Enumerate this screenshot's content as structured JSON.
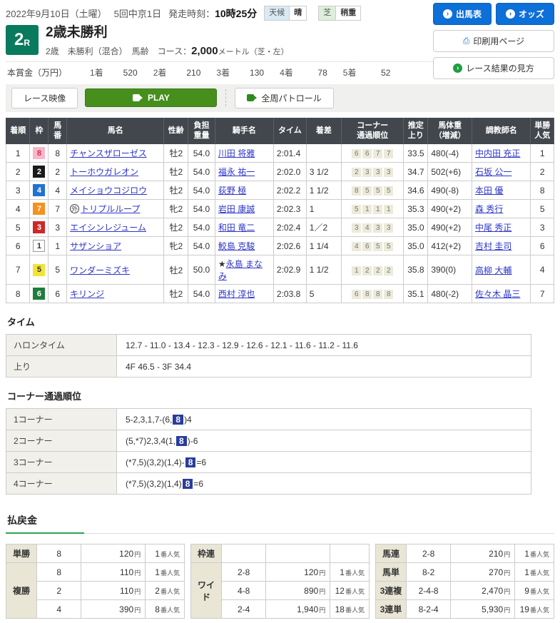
{
  "header": {
    "date": "2022年9月10日（土曜）",
    "meet": "5回中京1日",
    "start_label": "発走時刻：",
    "start_time": "10時25分",
    "weather_label": "天候",
    "weather_value": "晴",
    "turf_label": "芝",
    "turf_value": "稍重",
    "btn_shutsuba": "出馬表",
    "btn_odds": "オッズ",
    "btn_print": "印刷用ページ",
    "btn_guide": "レース結果の見方",
    "arrow_glyph": "›",
    "printer_glyph": "⎙"
  },
  "race": {
    "number": "2",
    "r_suffix": "R",
    "title": "2歳未勝利",
    "conditions": "2歳　未勝利（混合）　馬齢　コース：",
    "distance": "2,000",
    "distance_unit": "メートル（芝・左）"
  },
  "prize": {
    "label": "本賞金（万円）",
    "items": [
      {
        "rank": "1着",
        "amount": "520"
      },
      {
        "rank": "2着",
        "amount": "210"
      },
      {
        "rank": "3着",
        "amount": "130"
      },
      {
        "rank": "4着",
        "amount": "78"
      },
      {
        "rank": "5着",
        "amount": "52"
      }
    ]
  },
  "video_bar": {
    "race_video": "レース映像",
    "play": "PLAY",
    "patrol": "全周パトロール"
  },
  "frame_colors": {
    "1": {
      "bg": "#ffffff",
      "fg": "#333333",
      "border": "#999999"
    },
    "2": {
      "bg": "#1a1a1a",
      "fg": "#ffffff"
    },
    "3": {
      "bg": "#cc2929",
      "fg": "#ffffff"
    },
    "4": {
      "bg": "#2272d1",
      "fg": "#ffffff"
    },
    "5": {
      "bg": "#f2e436",
      "fg": "#333333"
    },
    "6": {
      "bg": "#1e7d3c",
      "fg": "#ffffff"
    },
    "7": {
      "bg": "#f5921e",
      "fg": "#ffffff"
    },
    "8": {
      "bg": "#f7b7ca",
      "fg": "#cc3355"
    }
  },
  "results": {
    "columns": [
      "着順",
      "枠",
      "馬\n番",
      "馬名",
      "性齢",
      "負担\n重量",
      "騎手名",
      "タイム",
      "着差",
      "コーナー\n通過順位",
      "推定\n上り",
      "馬体重\n（増減）",
      "調教師名",
      "単勝\n人気"
    ],
    "rows": [
      {
        "pos": "1",
        "frame": "8",
        "num": "8",
        "mark": "",
        "horse": "チャンスザローゼス",
        "sex_age": "牡2",
        "weight": "54.0",
        "jockey_mark": "",
        "jockey": "川田 将雅",
        "time": "2:01.4",
        "margin": "",
        "corners": [
          "6",
          "6",
          "7",
          "7"
        ],
        "last3f": "33.5",
        "horse_weight": "480(-4)",
        "trainer": "中内田 充正",
        "pop": "1"
      },
      {
        "pos": "2",
        "frame": "2",
        "num": "2",
        "mark": "",
        "horse": "トーホウガレオン",
        "sex_age": "牡2",
        "weight": "54.0",
        "jockey_mark": "",
        "jockey": "福永 祐一",
        "time": "2:02.0",
        "margin": "3 1/2",
        "corners": [
          "2",
          "3",
          "3",
          "3"
        ],
        "last3f": "34.7",
        "horse_weight": "502(+6)",
        "trainer": "石坂 公一",
        "pop": "2"
      },
      {
        "pos": "3",
        "frame": "4",
        "num": "4",
        "mark": "",
        "horse": "メイショウコジロウ",
        "sex_age": "牡2",
        "weight": "54.0",
        "jockey_mark": "",
        "jockey": "荻野 極",
        "time": "2:02.2",
        "margin": "1 1/2",
        "corners": [
          "8",
          "5",
          "5",
          "5"
        ],
        "last3f": "34.6",
        "horse_weight": "490(-8)",
        "trainer": "本田 優",
        "pop": "8"
      },
      {
        "pos": "4",
        "frame": "7",
        "num": "7",
        "mark": "外",
        "horse": "トリプルループ",
        "sex_age": "牝2",
        "weight": "54.0",
        "jockey_mark": "",
        "jockey": "岩田 康誠",
        "time": "2:02.3",
        "margin": "1",
        "corners": [
          "5",
          "1",
          "1",
          "1"
        ],
        "last3f": "35.3",
        "horse_weight": "490(+2)",
        "trainer": "森 秀行",
        "pop": "5"
      },
      {
        "pos": "5",
        "frame": "3",
        "num": "3",
        "mark": "",
        "horse": "エイシンレジューム",
        "sex_age": "牡2",
        "weight": "54.0",
        "jockey_mark": "",
        "jockey": "和田 竜二",
        "time": "2:02.4",
        "margin": "1／2",
        "corners": [
          "3",
          "4",
          "3",
          "3"
        ],
        "last3f": "35.0",
        "horse_weight": "490(+2)",
        "trainer": "中尾 秀正",
        "pop": "3"
      },
      {
        "pos": "6",
        "frame": "1",
        "num": "1",
        "mark": "",
        "horse": "サザンショア",
        "sex_age": "牝2",
        "weight": "54.0",
        "jockey_mark": "",
        "jockey": "鮫島 克駿",
        "time": "2:02.6",
        "margin": "1 1/4",
        "corners": [
          "4",
          "6",
          "5",
          "5"
        ],
        "last3f": "35.0",
        "horse_weight": "412(+2)",
        "trainer": "吉村 圭司",
        "pop": "6"
      },
      {
        "pos": "7",
        "frame": "5",
        "num": "5",
        "mark": "",
        "horse": "ワンダーミズキ",
        "sex_age": "牡2",
        "weight": "50.0",
        "jockey_mark": "★",
        "jockey": "永島 まなみ",
        "time": "2:02.9",
        "margin": "1 1/2",
        "corners": [
          "1",
          "2",
          "2",
          "2"
        ],
        "last3f": "35.8",
        "horse_weight": "390(0)",
        "trainer": "高柳 大輔",
        "pop": "4"
      },
      {
        "pos": "8",
        "frame": "6",
        "num": "6",
        "mark": "",
        "horse": "キリンジ",
        "sex_age": "牡2",
        "weight": "54.0",
        "jockey_mark": "",
        "jockey": "西村 淳也",
        "time": "2:03.8",
        "margin": "5",
        "corners": [
          "6",
          "8",
          "8",
          "8"
        ],
        "last3f": "35.1",
        "horse_weight": "480(-2)",
        "trainer": "佐々木 晶三",
        "pop": "7"
      }
    ]
  },
  "time_section": {
    "title": "タイム",
    "rows": [
      {
        "label": "ハロンタイム",
        "value": "12.7 - 11.0 - 13.4 - 12.3 - 12.9 - 12.6 - 12.1 - 11.6 - 11.2 - 11.6"
      },
      {
        "label": "上り",
        "value": "4F 46.5 - 3F 34.4"
      }
    ]
  },
  "corner_section": {
    "title": "コーナー通過順位",
    "rows": [
      {
        "label": "1コーナー",
        "pre": "5-2,3,1,7-(6,",
        "hl": "8",
        "post": ")4"
      },
      {
        "label": "2コーナー",
        "pre": "(5,*7)2,3,4(1,",
        "hl": "8",
        "post": ")-6"
      },
      {
        "label": "3コーナー",
        "pre": "(*7,5)(3,2)(1,4)-",
        "hl": "8",
        "post": "=6"
      },
      {
        "label": "4コーナー",
        "pre": "(*7,5)(3,2)(1,4)",
        "hl": "8",
        "post": "=6"
      }
    ]
  },
  "payouts": {
    "title": "払戻金",
    "col1": [
      {
        "label": "単勝",
        "rows": [
          {
            "combo": "8",
            "value": "120",
            "unit": "円",
            "pop": "1",
            "pop_unit": "番人気"
          }
        ]
      },
      {
        "label": "複勝",
        "rows": [
          {
            "combo": "8",
            "value": "110",
            "unit": "円",
            "pop": "1",
            "pop_unit": "番人気"
          },
          {
            "combo": "2",
            "value": "110",
            "unit": "円",
            "pop": "2",
            "pop_unit": "番人気"
          },
          {
            "combo": "4",
            "value": "390",
            "unit": "円",
            "pop": "8",
            "pop_unit": "番人気"
          }
        ]
      }
    ],
    "col2": [
      {
        "label": "枠連",
        "rows": [
          {
            "combo": "",
            "value": "",
            "unit": "",
            "pop": "",
            "pop_unit": ""
          }
        ]
      },
      {
        "label": "ワイド",
        "rows": [
          {
            "combo": "2-8",
            "value": "120",
            "unit": "円",
            "pop": "1",
            "pop_unit": "番人気"
          },
          {
            "combo": "4-8",
            "value": "890",
            "unit": "円",
            "pop": "12",
            "pop_unit": "番人気"
          },
          {
            "combo": "2-4",
            "value": "1,940",
            "unit": "円",
            "pop": "18",
            "pop_unit": "番人気"
          }
        ]
      }
    ],
    "col3": [
      {
        "label": "馬連",
        "rows": [
          {
            "combo": "2-8",
            "value": "210",
            "unit": "円",
            "pop": "1",
            "pop_unit": "番人気"
          }
        ]
      },
      {
        "label": "馬単",
        "rows": [
          {
            "combo": "8-2",
            "value": "270",
            "unit": "円",
            "pop": "1",
            "pop_unit": "番人気"
          }
        ]
      },
      {
        "label": "3連複",
        "rows": [
          {
            "combo": "2-4-8",
            "value": "2,470",
            "unit": "円",
            "pop": "9",
            "pop_unit": "番人気"
          }
        ]
      },
      {
        "label": "3連単",
        "rows": [
          {
            "combo": "8-2-4",
            "value": "5,930",
            "unit": "円",
            "pop": "19",
            "pop_unit": "番人気"
          }
        ]
      }
    ]
  }
}
